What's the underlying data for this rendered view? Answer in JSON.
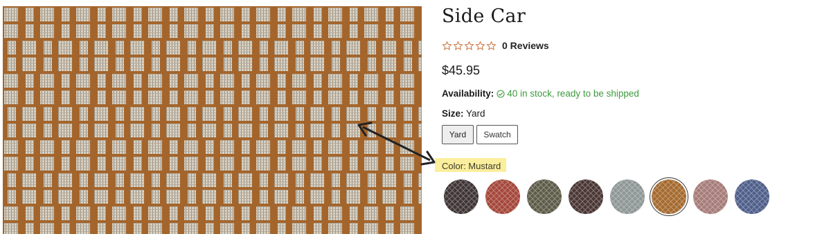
{
  "product": {
    "title": "Side Car",
    "reviews_text": "0 Reviews",
    "rating_stars": 0,
    "price": "$45.95",
    "availability_label": "Availability:",
    "availability_value": "40 in stock, ready to be shipped",
    "size_label": "Size:",
    "size_selected": "Yard",
    "size_options": [
      "Yard",
      "Swatch"
    ],
    "color_label": "Color: Mustard",
    "color_swatches": [
      {
        "name": "swatch-1",
        "color": "#3f3535"
      },
      {
        "name": "swatch-2",
        "color": "#a4473a"
      },
      {
        "name": "swatch-3",
        "color": "#5d5c49"
      },
      {
        "name": "swatch-4",
        "color": "#4a3735"
      },
      {
        "name": "swatch-5",
        "color": "#8f9796"
      },
      {
        "name": "swatch-6",
        "color": "#a56a2f",
        "selected": true
      },
      {
        "name": "swatch-7",
        "color": "#a67c79"
      },
      {
        "name": "swatch-8",
        "color": "#4f5f8a"
      }
    ]
  },
  "colors": {
    "accent_star": "#c9703a",
    "in_stock": "#3e9a3e",
    "highlight": "#fbee9c",
    "fabric_base": "#a4652c",
    "fabric_light": "#d8d2c4"
  },
  "icons": {
    "star": "star-outline-icon",
    "check": "check-circle-icon",
    "arrow": "double-headed-arrow-icon"
  }
}
